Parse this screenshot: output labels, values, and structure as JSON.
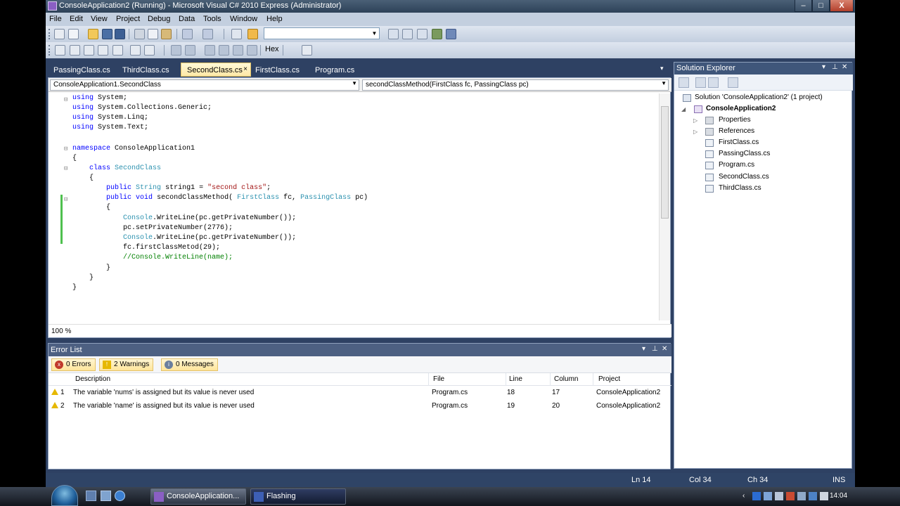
{
  "window": {
    "title": "ConsoleApplication2 (Running) - Microsoft Visual C# 2010 Express (Administrator)",
    "controls": {
      "minimize": "‒",
      "maximize": "□",
      "close": "X"
    }
  },
  "menu": [
    "File",
    "Edit",
    "View",
    "Project",
    "Debug",
    "Data",
    "Tools",
    "Window",
    "Help"
  ],
  "toolbar": {
    "hex_label": "Hex"
  },
  "tabs": [
    {
      "label": "PassingClass.cs",
      "active": false
    },
    {
      "label": "ThirdClass.cs",
      "active": false
    },
    {
      "label": "SecondClass.cs",
      "active": true,
      "close": "×"
    },
    {
      "label": "FirstClass.cs",
      "active": false
    },
    {
      "label": "Program.cs",
      "active": false
    }
  ],
  "tab_dropdown": "▾",
  "editor": {
    "nav_left": "ConsoleApplication1.SecondClass",
    "nav_right": "secondClassMethod(FirstClass fc, PassingClass pc)",
    "zoom": "100 %",
    "code_lines": [
      "using System;",
      "using System.Collections.Generic;",
      "using System.Linq;",
      "using System.Text;",
      "",
      "namespace ConsoleApplication1",
      "{",
      "    class SecondClass",
      "    {",
      "        public String string1 = \"second class\";",
      "        public void secondClassMethod( FirstClass fc, PassingClass pc)",
      "        {",
      "            Console.WriteLine(pc.getPrivateNumber());",
      "            pc.setPrivateNumber(2776);",
      "            Console.WriteLine(pc.getPrivateNumber());",
      "            fc.firstClassMetod(29);",
      "            //Console.WriteLine(name);",
      "        }",
      "    }",
      "}"
    ]
  },
  "error_list": {
    "title": "Error List",
    "filters": {
      "errors": "0 Errors",
      "warnings": "2 Warnings",
      "messages": "0 Messages"
    },
    "columns": {
      "description": "Description",
      "file": "File",
      "line": "Line",
      "column": "Column",
      "project": "Project"
    },
    "rows": [
      {
        "num": "1",
        "description": "The variable 'nums' is assigned but its value is never used",
        "file": "Program.cs",
        "line": "18",
        "column": "17",
        "project": "ConsoleApplication2"
      },
      {
        "num": "2",
        "description": "The variable 'name' is assigned but its value is never used",
        "file": "Program.cs",
        "line": "19",
        "column": "20",
        "project": "ConsoleApplication2"
      }
    ]
  },
  "solution_explorer": {
    "title": "Solution Explorer",
    "solution": "Solution 'ConsoleApplication2' (1 project)",
    "project": "ConsoleApplication2",
    "items": [
      "Properties",
      "References",
      "FirstClass.cs",
      "PassingClass.cs",
      "Program.cs",
      "SecondClass.cs",
      "ThirdClass.cs"
    ]
  },
  "status": {
    "ln": "Ln 14",
    "col": "Col 34",
    "ch": "Ch 34",
    "mode": "INS"
  },
  "taskbar": {
    "tasks": [
      "ConsoleApplication...",
      "Flashing"
    ],
    "clock": "14:04"
  },
  "colors": {
    "keyword": "#0000ff",
    "type": "#2b91af",
    "string": "#a31515",
    "accent": "#ffe8a6"
  }
}
